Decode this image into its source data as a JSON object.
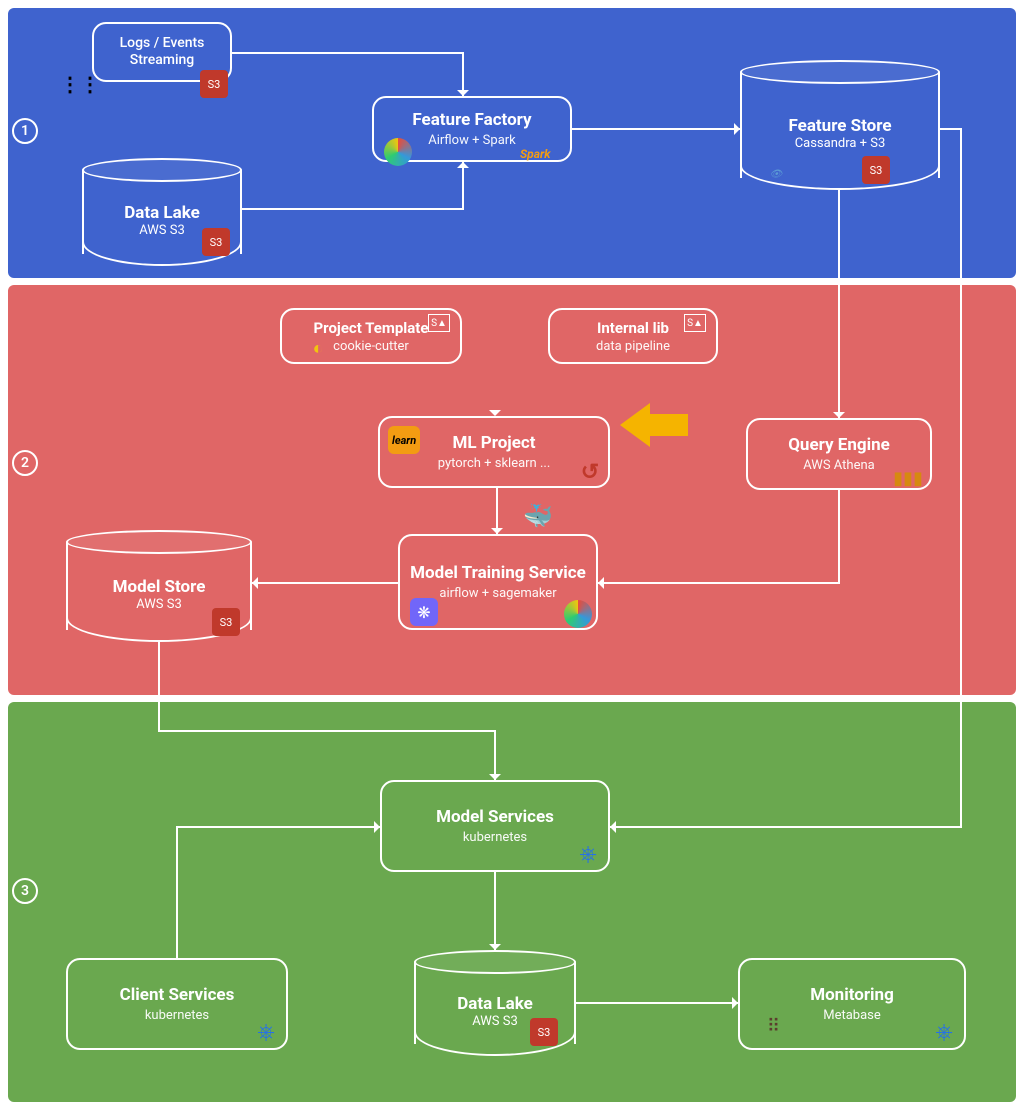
{
  "sections": {
    "one": {
      "num": "1"
    },
    "two": {
      "num": "2"
    },
    "three": {
      "num": "3"
    }
  },
  "nodes": {
    "logs": {
      "title": "Logs / Events Streaming"
    },
    "datalake1": {
      "title": "Data Lake",
      "sub": "AWS S3"
    },
    "featureFactory": {
      "title": "Feature Factory",
      "sub": "Airflow + Spark"
    },
    "featureStore": {
      "title": "Feature Store",
      "sub": "Cassandra  + S3"
    },
    "projectTemplate": {
      "title": "Project Template",
      "sub": "cookie-cutter"
    },
    "internalLib": {
      "title": "Internal lib",
      "sub": "data pipeline"
    },
    "mlProject": {
      "title": "ML Project",
      "sub": "pytorch + sklearn ..."
    },
    "queryEngine": {
      "title": "Query Engine",
      "sub": "AWS Athena"
    },
    "modelTraining": {
      "title": "Model Training Service",
      "sub": "airflow + sagemaker"
    },
    "modelStore": {
      "title": "Model Store",
      "sub": "AWS S3"
    },
    "modelServices": {
      "title": "Model Services",
      "sub": "kubernetes"
    },
    "clientServices": {
      "title": "Client Services",
      "sub": "kubernetes"
    },
    "datalake2": {
      "title": "Data Lake",
      "sub": "AWS S3"
    },
    "monitoring": {
      "title": "Monitoring",
      "sub": "Metabase"
    }
  },
  "icons": {
    "s3": "S3",
    "kafka": "⋔",
    "spark": "Spark",
    "sklearn": "learn",
    "pytorch": "↺",
    "docker": "🐳",
    "sagemaker": "❋",
    "k8s": "⎈",
    "athena": "▮",
    "metabase": "⠿",
    "cassandra": "👁",
    "cookie": "◐",
    "tag": "S▲"
  }
}
